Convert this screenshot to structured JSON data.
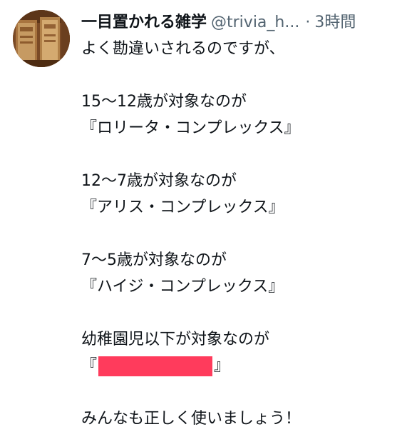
{
  "header": {
    "display_name": "一目置かれる雑学",
    "handle": "@trivia_h...",
    "separator": "·",
    "time": "3時間"
  },
  "body": {
    "intro": "よく勘違いされるのですが、",
    "item1_cond": "15〜12歳が対象なのが",
    "item1_name": "『ロリータ・コンプレックス』",
    "item2_cond": "12〜7歳が対象なのが",
    "item2_name": "『アリス・コンプレックス』",
    "item3_cond": "7〜5歳が対象なのが",
    "item3_name": "『ハイジ・コンプレックス』",
    "item4_cond": "幼稚園児以下が対象なのが",
    "item4_open": "『",
    "item4_close": "』",
    "closing": "みんなも正しく使いましょう！"
  },
  "colors": {
    "text": "#0f1419",
    "secondary": "#536471",
    "redaction": "#ff3b5c"
  }
}
